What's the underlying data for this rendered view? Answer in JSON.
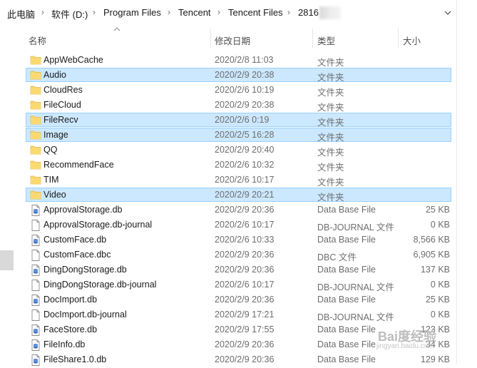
{
  "breadcrumb": {
    "items": [
      "此电脑",
      "软件 (D:)",
      "Program Files",
      "Tencent",
      "Tencent Files",
      "2816"
    ]
  },
  "columns": {
    "name": "名称",
    "date": "修改日期",
    "type": "类型",
    "size": "大小"
  },
  "rows": [
    {
      "name": "AppWebCache",
      "date": "2020/2/8 11:03",
      "type": "文件夹",
      "size": "",
      "icon": "folder-icon",
      "selected": false
    },
    {
      "name": "Audio",
      "date": "2020/2/9 20:38",
      "type": "文件夹",
      "size": "",
      "icon": "folder-icon",
      "selected": true
    },
    {
      "name": "CloudRes",
      "date": "2020/2/6 10:19",
      "type": "文件夹",
      "size": "",
      "icon": "folder-icon",
      "selected": false
    },
    {
      "name": "FileCloud",
      "date": "2020/2/9 20:38",
      "type": "文件夹",
      "size": "",
      "icon": "folder-icon",
      "selected": false
    },
    {
      "name": "FileRecv",
      "date": "2020/2/6 0:19",
      "type": "文件夹",
      "size": "",
      "icon": "folder-icon",
      "selected": true
    },
    {
      "name": "Image",
      "date": "2020/2/5 16:28",
      "type": "文件夹",
      "size": "",
      "icon": "folder-icon",
      "selected": true
    },
    {
      "name": "QQ",
      "date": "2020/2/9 20:40",
      "type": "文件夹",
      "size": "",
      "icon": "folder-icon",
      "selected": false
    },
    {
      "name": "RecommendFace",
      "date": "2020/2/6 10:32",
      "type": "文件夹",
      "size": "",
      "icon": "folder-icon",
      "selected": false
    },
    {
      "name": "TIM",
      "date": "2020/2/6 10:17",
      "type": "文件夹",
      "size": "",
      "icon": "folder-icon",
      "selected": false
    },
    {
      "name": "Video",
      "date": "2020/2/9 20:21",
      "type": "文件夹",
      "size": "",
      "icon": "folder-icon",
      "selected": true
    },
    {
      "name": "ApprovalStorage.db",
      "date": "2020/2/9 20:36",
      "type": "Data Base File",
      "size": "25 KB",
      "icon": "database-file-icon",
      "selected": false
    },
    {
      "name": "ApprovalStorage.db-journal",
      "date": "2020/2/6 10:17",
      "type": "DB-JOURNAL 文件",
      "size": "0 KB",
      "icon": "blank-file-icon",
      "selected": false
    },
    {
      "name": "CustomFace.db",
      "date": "2020/2/6 10:33",
      "type": "Data Base File",
      "size": "8,566 KB",
      "icon": "database-file-icon",
      "selected": false
    },
    {
      "name": "CustomFace.dbc",
      "date": "2020/2/9 20:36",
      "type": "DBC 文件",
      "size": "6,905 KB",
      "icon": "blank-file-icon",
      "selected": false
    },
    {
      "name": "DingDongStorage.db",
      "date": "2020/2/9 20:36",
      "type": "Data Base File",
      "size": "137 KB",
      "icon": "database-file-icon",
      "selected": false
    },
    {
      "name": "DingDongStorage.db-journal",
      "date": "2020/2/6 10:17",
      "type": "DB-JOURNAL 文件",
      "size": "0 KB",
      "icon": "blank-file-icon",
      "selected": false
    },
    {
      "name": "DocImport.db",
      "date": "2020/2/9 20:36",
      "type": "Data Base File",
      "size": "25 KB",
      "icon": "database-file-icon",
      "selected": false
    },
    {
      "name": "DocImport.db-journal",
      "date": "2020/2/9 17:21",
      "type": "DB-JOURNAL 文件",
      "size": "0 KB",
      "icon": "blank-file-icon",
      "selected": false
    },
    {
      "name": "FaceStore.db",
      "date": "2020/2/9 17:55",
      "type": "Data Base File",
      "size": "123 KB",
      "icon": "database-file-icon",
      "selected": false
    },
    {
      "name": "FileInfo.db",
      "date": "2020/2/9 20:36",
      "type": "Data Base File",
      "size": "34 KB",
      "icon": "database-file-icon",
      "selected": false
    },
    {
      "name": "FileShare1.0.db",
      "date": "2020/2/9 20:36",
      "type": "Data Base File",
      "size": "129 KB",
      "icon": "database-file-icon",
      "selected": false
    }
  ],
  "watermark": {
    "text": "Bai度经验",
    "sub": "jingyan.baidu.com"
  },
  "colors": {
    "selection_bg": "#cce8ff",
    "selection_border": "#99d1ff",
    "folder": "#f8d775"
  }
}
